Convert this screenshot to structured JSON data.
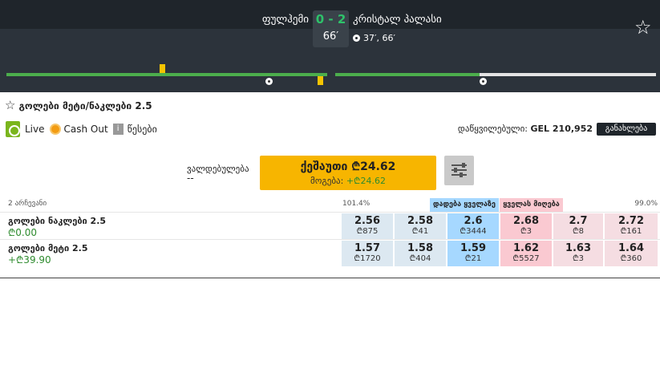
{
  "event": {
    "home_team": "ფულჰემი",
    "away_team": "კრისტალ პალასი",
    "score": "0 - 2",
    "minute": "66′",
    "goal_times": "37′, 66′",
    "timeline_progress_fraction": 0.45
  },
  "market": {
    "title": "გოლები მეტი/ნაკლები 2.5",
    "live_label": "Live",
    "cashout_label": "Cash Out",
    "info_label": "i",
    "rules_label": "წესები",
    "matched_label": "დაწყვილებული:",
    "matched_value": "GEL 210,952",
    "expand_button": "განახლება"
  },
  "cashout": {
    "liabilities_label": "ვალდებულება",
    "liabilities_value": "--",
    "button_main": "ქეშაუთი ₾24.62",
    "profit_label": "მოგება:",
    "profit_value": "+₾24.62"
  },
  "grid": {
    "selections_label": "2 არჩევანი",
    "back_overround": "101.4%",
    "lay_overround": "99.0%",
    "back_all_label": "დადება ყველაზე",
    "lay_all_label": "ყველას მიღება"
  },
  "runners": [
    {
      "name": "გოლები ნაკლები 2.5",
      "pl": "₾0.00",
      "prices": [
        {
          "price": "2.56",
          "size": "₾875"
        },
        {
          "price": "2.58",
          "size": "₾41"
        },
        {
          "price": "2.6",
          "size": "₾3444"
        },
        {
          "price": "2.68",
          "size": "₾3"
        },
        {
          "price": "2.7",
          "size": "₾8"
        },
        {
          "price": "2.72",
          "size": "₾161"
        }
      ]
    },
    {
      "name": "გოლები მეტი 2.5",
      "pl": "+₾39.90",
      "prices": [
        {
          "price": "1.57",
          "size": "₾1720"
        },
        {
          "price": "1.58",
          "size": "₾404"
        },
        {
          "price": "1.59",
          "size": "₾21"
        },
        {
          "price": "1.62",
          "size": "₾5527"
        },
        {
          "price": "1.63",
          "size": "₾3"
        },
        {
          "price": "1.64",
          "size": "₾360"
        }
      ]
    }
  ]
}
